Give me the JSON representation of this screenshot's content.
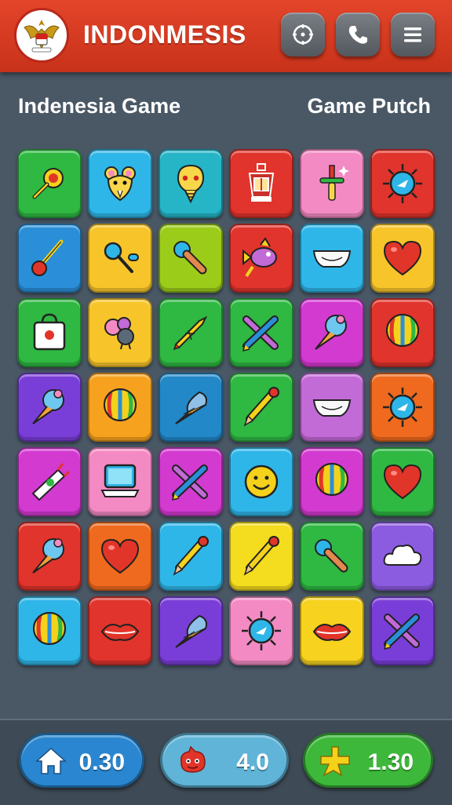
{
  "header": {
    "title": "INDONMESIS",
    "logo_icon": "garuda-emblem-icon",
    "buttons": [
      {
        "icon": "target-icon"
      },
      {
        "icon": "phone-icon"
      },
      {
        "icon": "hamburger-menu-icon"
      }
    ],
    "color": "#d63b22"
  },
  "subtitles": {
    "left": "Indenesia Game",
    "right": "Game Putch"
  },
  "grid": {
    "rows": 7,
    "cols": 6,
    "tiles": [
      {
        "icon": "lollipop-icon",
        "color": "#2fb842"
      },
      {
        "icon": "mouse-face-icon",
        "color": "#2fb6e8"
      },
      {
        "icon": "bulb-face-icon",
        "color": "#25b5c7"
      },
      {
        "icon": "lantern-icon",
        "color": "#e0342c"
      },
      {
        "icon": "sparkle-wand-icon",
        "color": "#f48ac4"
      },
      {
        "icon": "sun-badge-icon",
        "color": "#e0342c"
      },
      {
        "icon": "paintbrush-icon",
        "color": "#2a8fd8"
      },
      {
        "icon": "magnifier-icon",
        "color": "#f7c52a"
      },
      {
        "icon": "microphone-icon",
        "color": "#9ccc1a"
      },
      {
        "icon": "fish-icon",
        "color": "#e0342c"
      },
      {
        "icon": "bowl-icon",
        "color": "#2fb6e8"
      },
      {
        "icon": "heart-icon",
        "color": "#f7c52a"
      },
      {
        "icon": "bag-icon",
        "color": "#2fb842"
      },
      {
        "icon": "cloud-blob-icon",
        "color": "#f7c52a"
      },
      {
        "icon": "rocket-icon",
        "color": "#2fb842"
      },
      {
        "icon": "crossed-pencils-icon",
        "color": "#2fb842"
      },
      {
        "icon": "ice-cream-icon",
        "color": "#d33ad0"
      },
      {
        "icon": "striped-balloon-icon",
        "color": "#e0342c"
      },
      {
        "icon": "ice-cream-icon",
        "color": "#7a3ed8"
      },
      {
        "icon": "striped-balloon-icon",
        "color": "#f7a21e"
      },
      {
        "icon": "cone-icon",
        "color": "#2288c8"
      },
      {
        "icon": "pencil-icon",
        "color": "#2fb842"
      },
      {
        "icon": "bowl-icon",
        "color": "#c26ad6"
      },
      {
        "icon": "sun-badge-icon",
        "color": "#ef6a1e"
      },
      {
        "icon": "candy-wrapper-icon",
        "color": "#d33ad0"
      },
      {
        "icon": "laptop-icon",
        "color": "#f48ac4"
      },
      {
        "icon": "crossed-pencils-icon",
        "color": "#d33ad0"
      },
      {
        "icon": "smiley-icon",
        "color": "#2fb6e8"
      },
      {
        "icon": "striped-balloon-icon",
        "color": "#d33ad0"
      },
      {
        "icon": "heart-icon",
        "color": "#2fb842"
      },
      {
        "icon": "ice-cream-icon",
        "color": "#e0342c"
      },
      {
        "icon": "heart-icon",
        "color": "#ef6a1e"
      },
      {
        "icon": "pencil-icon",
        "color": "#2fb6e8"
      },
      {
        "icon": "pencil-icon",
        "color": "#f4dc1e"
      },
      {
        "icon": "microphone-icon",
        "color": "#2fb842"
      },
      {
        "icon": "cloud-icon",
        "color": "#8b5be0"
      },
      {
        "icon": "striped-balloon-icon",
        "color": "#2fb6e8"
      },
      {
        "icon": "lips-icon",
        "color": "#e0342c"
      },
      {
        "icon": "cone-icon",
        "color": "#7a3ed8"
      },
      {
        "icon": "sun-badge-icon",
        "color": "#f48ac4"
      },
      {
        "icon": "lips-icon",
        "color": "#f7d21e"
      },
      {
        "icon": "crossed-pencils-icon",
        "color": "#7a3ed8"
      }
    ]
  },
  "footer": {
    "stats": [
      {
        "icon": "home-icon",
        "value": "0.30",
        "color": "#2a86d0"
      },
      {
        "icon": "red-blob-icon",
        "value": "4.0",
        "color": "#5fb4d8"
      },
      {
        "icon": "star-plus-icon",
        "value": "1.30",
        "color": "#3db83a"
      }
    ]
  }
}
